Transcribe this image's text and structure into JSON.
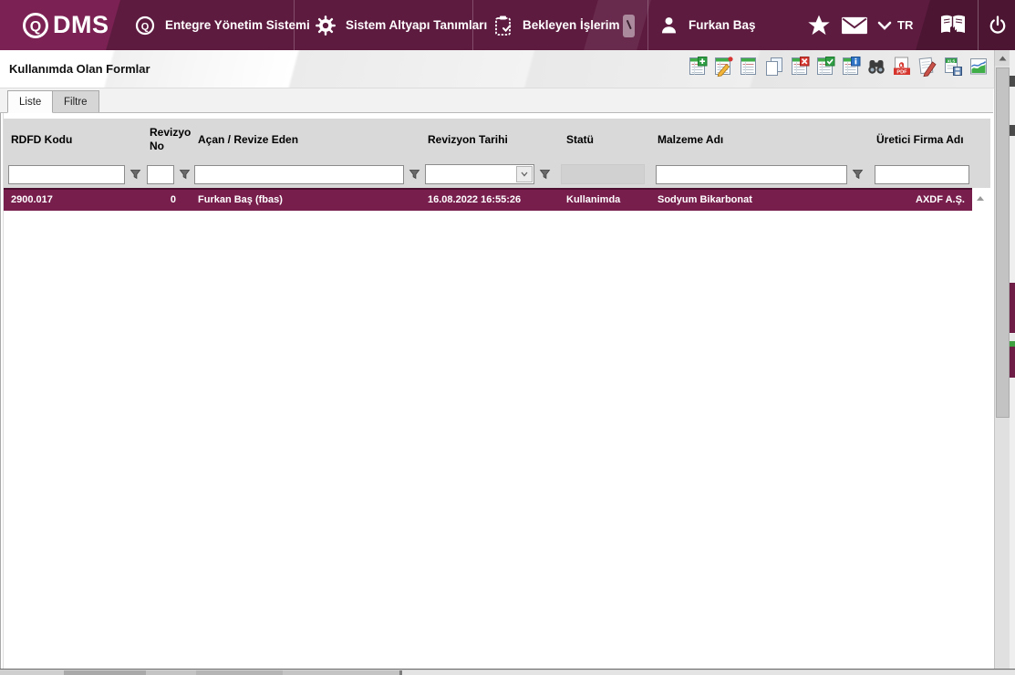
{
  "navbar": {
    "logo_text": "DMS",
    "menu": [
      {
        "label": "Entegre Yönetim Sistemi",
        "icon": "qdms-circle-icon"
      },
      {
        "label": "Sistem Altyapı Tanımları",
        "icon": "gear-icon"
      },
      {
        "label": "Bekleyen İşlerim",
        "icon": "clipboard-check-icon"
      }
    ],
    "user_name": "Furkan Baş",
    "language": "TR",
    "right_icons": [
      "star-icon",
      "mail-icon",
      "chevron-down-icon",
      "manual-book-icon",
      "power-icon"
    ]
  },
  "page": {
    "title": "Kullanımda Olan Formlar"
  },
  "toolbar": {
    "icons": [
      "add-record",
      "edit-record",
      "list-record",
      "copy-record",
      "delete-record",
      "approve-record",
      "record-info",
      "search-records",
      "export-pdf",
      "edit-document",
      "export-excel",
      "report-chart"
    ]
  },
  "tabs": [
    {
      "label": "Liste",
      "active": true
    },
    {
      "label": "Filtre",
      "active": false
    }
  ],
  "grid": {
    "columns": [
      {
        "label": "RDFD Kodu"
      },
      {
        "label": "Revizyon No"
      },
      {
        "label": "Açan / Revize Eden"
      },
      {
        "label": "Revizyon Tarihi"
      },
      {
        "label": "Statü"
      },
      {
        "label": "Malzeme Adı"
      },
      {
        "label": "Üretici Firma Adı"
      }
    ],
    "filters": [
      "",
      "",
      "",
      "",
      "",
      "",
      ""
    ],
    "rows": [
      {
        "cells": [
          "2900.017",
          "0",
          "Furkan Baş (fbas)",
          "16.08.2022 16:55:26",
          "Kullanimda",
          "Sodyum Bikarbonat",
          "AXDF A.Ş."
        ]
      }
    ]
  },
  "colors": {
    "navbar_bg": "#5e1b40",
    "navbar_logo_bg": "#7c2153",
    "navbar_right_bg": "#4c1532",
    "selected_row_bg": "#771e4d",
    "grid_header_bg": "#d9d9d9",
    "accent_green": "#3fae49"
  }
}
